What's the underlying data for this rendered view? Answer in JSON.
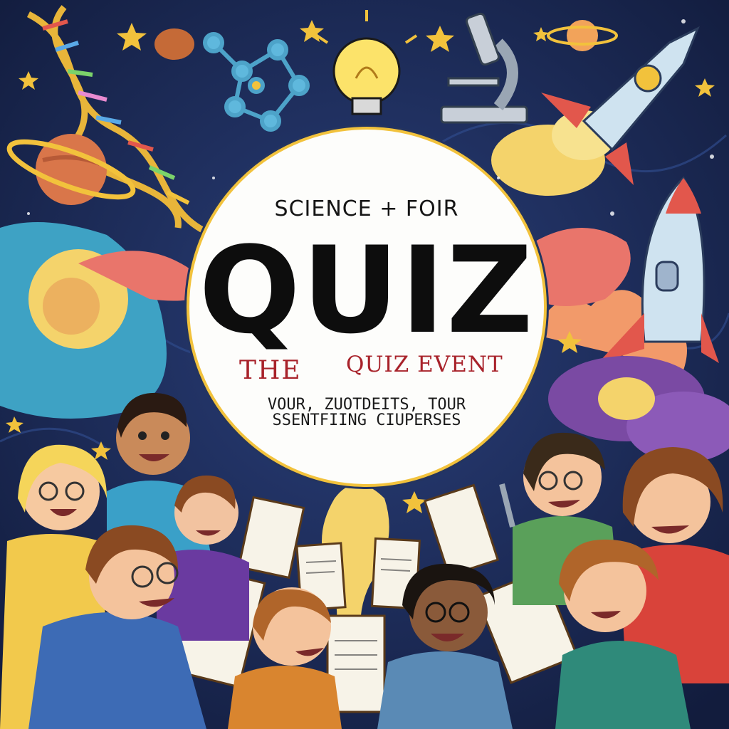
{
  "poster": {
    "supertitle": "SCIENCE + FOIR",
    "title": "QUIZ",
    "subtitle_left": "THE",
    "subtitle_right": "QUIZ EVENT",
    "tagline_line1": "VOUR, ZUOTDEITS, TOUR",
    "tagline_line2": "SSENTFIING CIUPERSES"
  },
  "colors": {
    "background": "#1b2a55",
    "circle_fill": "#fdfdfb",
    "circle_border": "#f2c23c",
    "title": "#0d0d0d",
    "subtitle": "#a8222a"
  },
  "icons": [
    "dna-icon",
    "molecule-icon",
    "lightbulb-icon",
    "microscope-icon",
    "planet-icon",
    "rocket-icon",
    "star-icon",
    "clipboard-icon"
  ]
}
